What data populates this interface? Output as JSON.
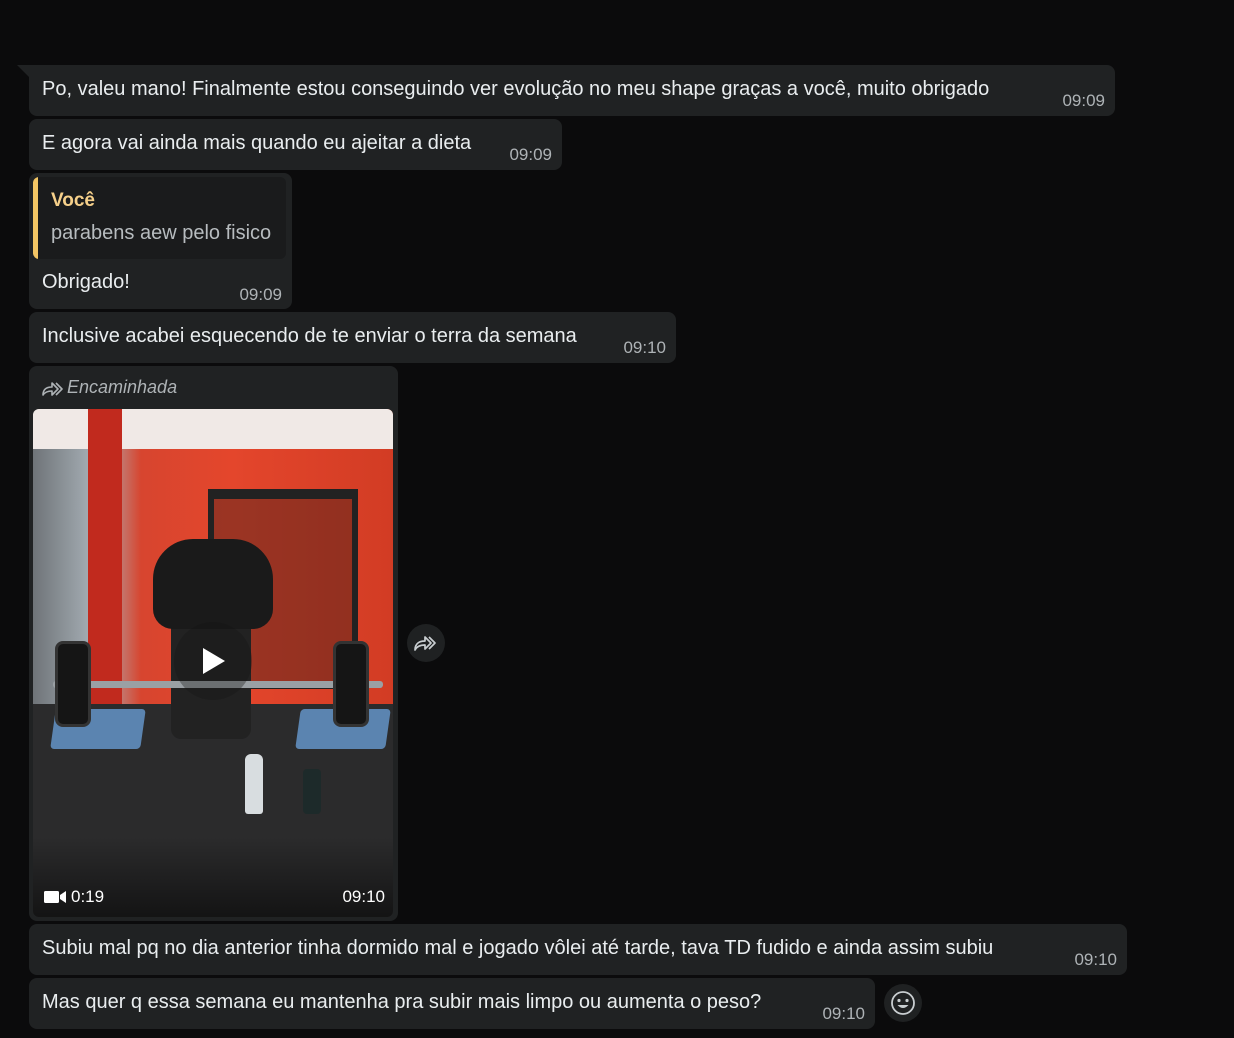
{
  "messages": [
    {
      "text": "Po, valeu mano! Finalmente estou conseguindo ver evolução no meu shape graças a você, muito obrigado",
      "time": "09:09"
    },
    {
      "text": "E agora vai ainda mais quando eu ajeitar a dieta",
      "time": "09:09"
    },
    {
      "reply_to": {
        "author": "Você",
        "text": "parabens aew pelo fisico"
      },
      "text": "Obrigado!",
      "time": "09:09"
    },
    {
      "text": "Inclusive acabei esquecendo de te enviar o terra da semana",
      "time": "09:10"
    },
    {
      "forwarded_label": "Encaminhada",
      "video": {
        "duration": "0:19"
      },
      "time": "09:10"
    },
    {
      "text": "Subiu mal pq no dia anterior tinha dormido mal e jogado vôlei até tarde, tava TD fudido e ainda assim subiu",
      "time": "09:10"
    },
    {
      "text": "Mas quer q essa semana eu mantenha pra subir mais limpo ou aumenta o peso?",
      "time": "09:10"
    }
  ],
  "icons": {
    "forward": "forward-icon",
    "play": "play-icon",
    "video_camera": "video-camera-icon",
    "emoji": "emoji-icon"
  },
  "colors": {
    "background": "#0b0b0c",
    "bubble": "#202223",
    "reply_accent": "#f3c564",
    "reply_author": "#f6d08a",
    "timestamp": "#aeb3b6"
  }
}
